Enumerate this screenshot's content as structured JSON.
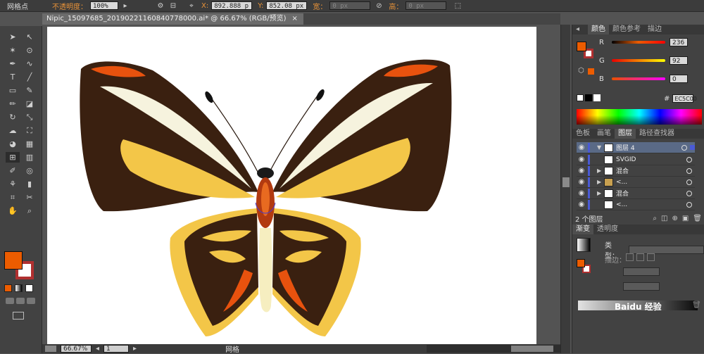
{
  "control_bar": {
    "label": "网格点",
    "opacity_label": "不透明度：",
    "opacity_value": "100%",
    "x_label": "X:",
    "x_value": "892.888 p",
    "y_label": "Y:",
    "y_value": "852.08 px",
    "w_label": "宽：",
    "w_value": "0 px",
    "h_label": "高：",
    "h_value": "0 px"
  },
  "document_tab": {
    "title": "Nipic_15097685_20190221160840778000.ai* @ 66.67% (RGB/预览)",
    "close": "×"
  },
  "status_bar": {
    "zoom": "66.67%",
    "page": "1",
    "tool_status": "网格"
  },
  "color_panel": {
    "tabs": [
      "颜色",
      "颜色参考",
      "描边"
    ],
    "channels": [
      {
        "name": "R",
        "value": "236"
      },
      {
        "name": "G",
        "value": "92"
      },
      {
        "name": "B",
        "value": "0"
      }
    ],
    "hex_label": "#",
    "hex_value": "EC5C00",
    "fill_color": "#ec5c00"
  },
  "layers_panel": {
    "tabs": [
      "色板",
      "画笔",
      "图层",
      "路径查找器"
    ],
    "rows": [
      {
        "name": "图层 4",
        "top": true
      },
      {
        "name": "SVGID"
      },
      {
        "name": "混合"
      },
      {
        "name": "<..."
      },
      {
        "name": "混合"
      },
      {
        "name": "<..."
      }
    ],
    "footer": "2 个图层"
  },
  "gradient_panel": {
    "tabs": [
      "渐变",
      "透明度"
    ],
    "type_label": "类型：",
    "stroke_label": "描边："
  },
  "watermark": "Baidu 经验",
  "colors": {
    "accent": "#ec5c00",
    "wing_dark": "#3a2010",
    "wing_yellow": "#f3c648",
    "wing_cream": "#f6f3de"
  }
}
